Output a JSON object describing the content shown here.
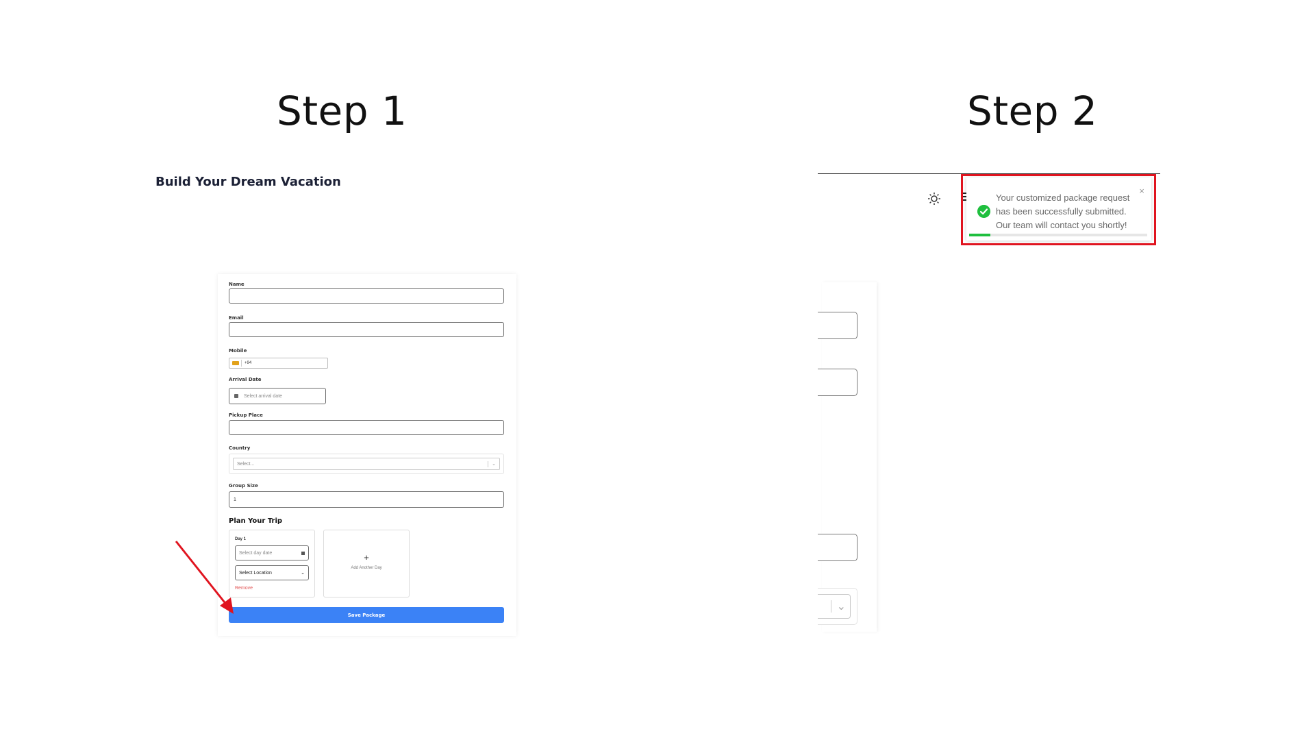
{
  "step1": {
    "title": "Step 1",
    "heading": "Build Your Dream Vacation",
    "form": {
      "name_label": "Name",
      "email_label": "Email",
      "mobile_label": "Mobile",
      "mobile_code": "+94",
      "arrival_label": "Arrival Date",
      "arrival_placeholder": "Select arrival date",
      "pickup_label": "Pickup Place",
      "country_label": "Country",
      "country_placeholder": "Select...",
      "group_label": "Group Size",
      "group_value": "1",
      "plan_title": "Plan Your Trip",
      "day_label": "Day 1",
      "day_date_placeholder": "Select day date",
      "location_value": "Select Location",
      "remove_label": "Remove",
      "add_plus": "+",
      "add_label": "Add Another Day",
      "save_label": "Save Package"
    },
    "arrow_color": "#e0141f",
    "button_color": "#3b82f6"
  },
  "step2": {
    "title": "Step 2",
    "toast": {
      "message": "Your customized package request has been successfully submitted. Our team will contact you shortly!",
      "close": "×",
      "progress": 0.12,
      "status_color": "#1fbf3e"
    },
    "icons": [
      "sun-icon",
      "menu-icon"
    ],
    "highlight_color": "#e0141f"
  }
}
